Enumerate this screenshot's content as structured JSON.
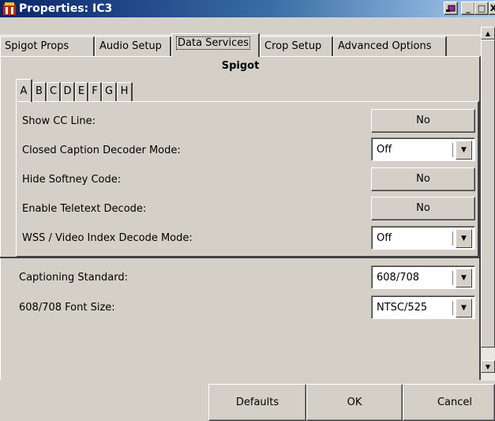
{
  "window": {
    "title": "Properties: IC3",
    "controls": {
      "restore": "▫",
      "minimize": "_",
      "maximize": "□",
      "close": "X"
    }
  },
  "tabs": [
    {
      "label": "Spigot Props"
    },
    {
      "label": "Audio Setup"
    },
    {
      "label": "Data Services",
      "active": true
    },
    {
      "label": "Crop Setup"
    },
    {
      "label": "Advanced Options"
    }
  ],
  "section_title": "Spigot",
  "subtabs": [
    {
      "label": "A",
      "active": true
    },
    {
      "label": "B"
    },
    {
      "label": "C"
    },
    {
      "label": "D"
    },
    {
      "label": "E"
    },
    {
      "label": "F"
    },
    {
      "label": "G"
    },
    {
      "label": "H"
    }
  ],
  "rows": [
    {
      "label": "Show CC Line:",
      "control": "button",
      "value": "No"
    },
    {
      "label": "Closed Caption Decoder Mode:",
      "control": "select",
      "value": "Off"
    },
    {
      "label": "Hide Softney Code:",
      "control": "button",
      "value": "No"
    },
    {
      "label": "Enable Teletext Decode:",
      "control": "button",
      "value": "No"
    },
    {
      "label": "WSS / Video Index Decode Mode:",
      "control": "select",
      "value": "Off"
    }
  ],
  "global_rows": [
    {
      "label": "Captioning Standard:",
      "control": "select",
      "value": "608/708"
    },
    {
      "label": "608/708 Font Size:",
      "control": "select",
      "value": "NTSC/525"
    }
  ],
  "footer": {
    "defaults_label": "Defaults",
    "ok_label": "OK",
    "cancel_label": "Cancel"
  },
  "colors": {
    "titlebar_start": "#0a246a",
    "titlebar_end": "#a6caf0",
    "face": "#d4d0c8"
  }
}
